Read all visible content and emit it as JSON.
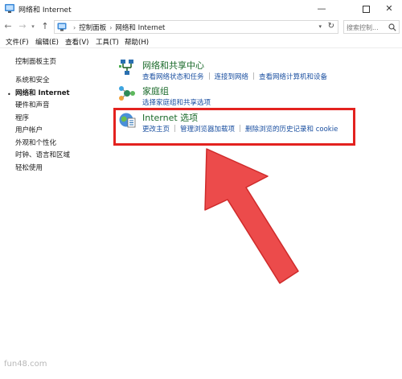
{
  "window": {
    "title": "网络和 Internet",
    "min_glyph": "—",
    "close_glyph": "✕"
  },
  "address_bar": {
    "crumbs": [
      "控制面板",
      "网络和 Internet"
    ],
    "search_placeholder": "搜索控制..."
  },
  "menu": [
    "文件(F)",
    "编辑(E)",
    "查看(V)",
    "工具(T)",
    "帮助(H)"
  ],
  "sidebar": {
    "items": [
      {
        "label": "控制面板主页",
        "active": false
      },
      {
        "label": "系统和安全",
        "active": false
      },
      {
        "label": "网络和 Internet",
        "active": true
      },
      {
        "label": "硬件和声音",
        "active": false
      },
      {
        "label": "程序",
        "active": false
      },
      {
        "label": "用户帐户",
        "active": false
      },
      {
        "label": "外观和个性化",
        "active": false
      },
      {
        "label": "时钟、语言和区域",
        "active": false
      },
      {
        "label": "轻松使用",
        "active": false
      }
    ]
  },
  "categories": [
    {
      "title": "网络和共享中心",
      "icon": "network-sharing-icon",
      "links": [
        "查看网络状态和任务",
        "连接到网络",
        "查看网络计算机和设备"
      ]
    },
    {
      "title": "家庭组",
      "icon": "homegroup-icon",
      "links": [
        "选择家庭组和共享选项"
      ]
    },
    {
      "title": "Internet 选项",
      "icon": "internet-options-icon",
      "links": [
        "更改主页",
        "管理浏览器加载项",
        "删除浏览的历史记录和 cookie"
      ]
    }
  ],
  "annotation": {
    "color": "#e3221f"
  },
  "watermark": "fun48.com"
}
